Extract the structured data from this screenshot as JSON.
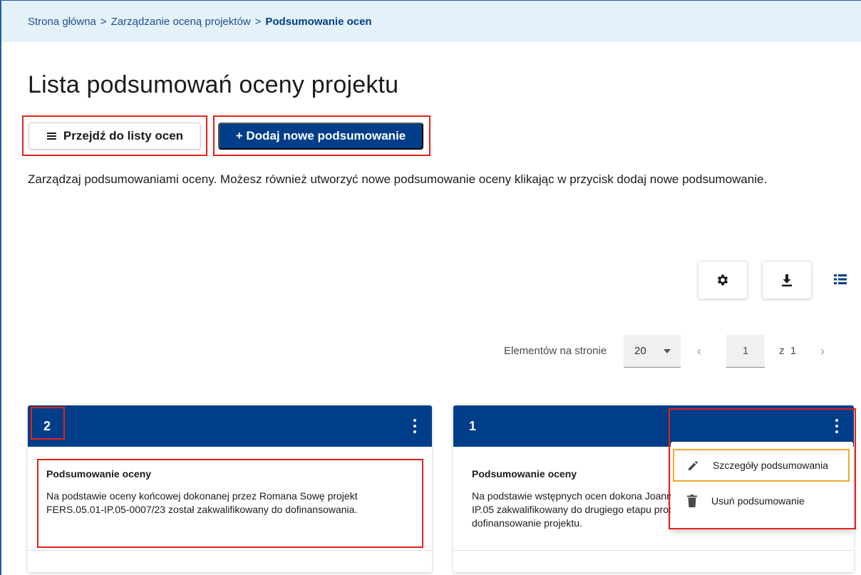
{
  "breadcrumb": {
    "home": "Strona główna",
    "section": "Zarządzanie oceną projektów",
    "current": "Podsumowanie ocen",
    "separator": ">"
  },
  "page": {
    "title": "Lista podsumowań oceny projektu",
    "description": "Zarządzaj podsumowaniami oceny. Możesz również utworzyć nowe podsumowanie oceny klikając w przycisk dodaj nowe podsumowanie."
  },
  "actions": {
    "go_to_list_label": "Przejdź do listy ocen",
    "add_new_label": "+ Dodaj nowe podsumowanie"
  },
  "toolbar": {
    "settings_icon": "gear-icon",
    "download_icon": "download-icon",
    "view_icon": "list-view-icon"
  },
  "pagination": {
    "per_page_label": "Elementów na stronie",
    "per_page_value": "20",
    "current_page": "1",
    "of_label": "z",
    "total_pages": "1"
  },
  "cards": [
    {
      "number": "2",
      "subtitle": "Podsumowanie oceny",
      "text": "Na podstawie oceny końcowej dokonanej przez Romana Sowę projekt FERS.05.01-IP.05-0007/23 został zakwalifikowany do dofinansowania."
    },
    {
      "number": "1",
      "subtitle": "Podsumowanie oceny",
      "text": "Na podstawie wstępnych ocen dokona Joannę Sowę projekt FERS.05.01-IP.05 zakwalifikowany do drugiego etapu procesu oceny wniosków o dofinansowanie projektu."
    }
  ],
  "context_menu": {
    "details_label": "Szczegóły podsumowania",
    "delete_label": "Usuń podsumowanie"
  },
  "colors": {
    "primary": "#003e8a",
    "highlight": "#e2231a",
    "focus": "#f0a830",
    "breadcrumb_bg": "#e4f1f9"
  }
}
